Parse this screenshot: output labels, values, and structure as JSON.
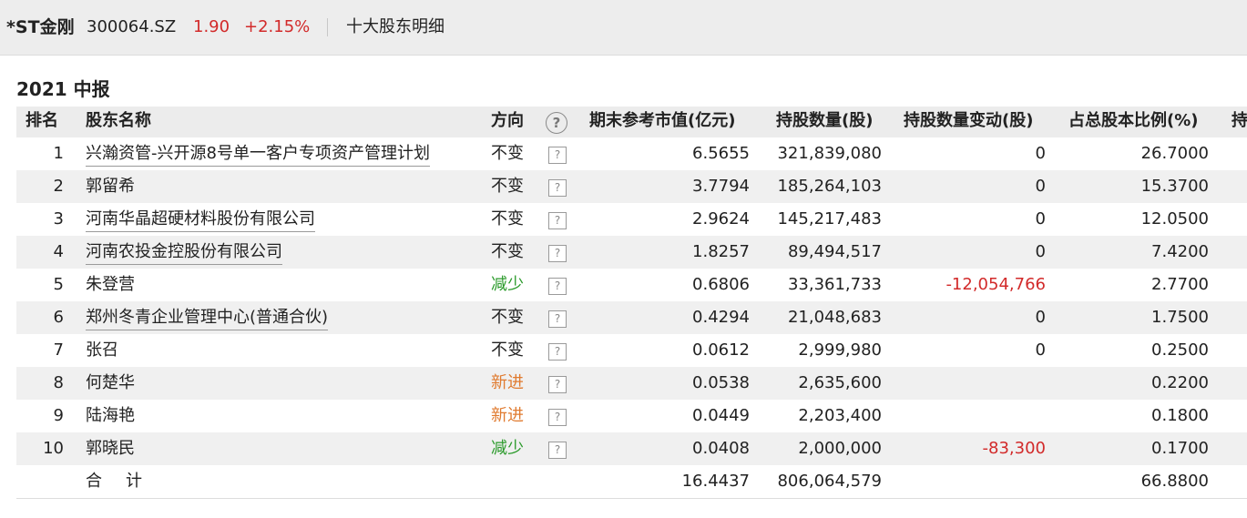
{
  "header": {
    "stock_name": "*ST金刚",
    "stock_code": "300064.SZ",
    "price": "1.90",
    "change": "+2.15%",
    "subtitle": "十大股东明细",
    "colors": {
      "price": "#d22a2a",
      "background": "#ededed"
    }
  },
  "section": {
    "title": "2021 中报"
  },
  "table": {
    "headers": {
      "rank": "排名",
      "name": "股东名称",
      "direction": "方向",
      "help_icon": "?",
      "market_value": "期末参考市值(亿元)",
      "shares": "持股数量(股)",
      "share_change": "持股数量变动(股)",
      "ratio": "占总股本比例(%)",
      "extra": "持"
    },
    "help_glyph": "?",
    "rows": [
      {
        "rank": "1",
        "name": "兴瀚资管-兴开源8号单一客户专项资产管理计划",
        "direction": "不变",
        "market_value": "6.5655",
        "shares": "321,839,080",
        "change": "0",
        "ratio": "26.7000"
      },
      {
        "rank": "2",
        "name": "郭留希",
        "direction": "不变",
        "market_value": "3.7794",
        "shares": "185,264,103",
        "change": "0",
        "ratio": "15.3700"
      },
      {
        "rank": "3",
        "name": "河南华晶超硬材料股份有限公司",
        "direction": "不变",
        "market_value": "2.9624",
        "shares": "145,217,483",
        "change": "0",
        "ratio": "12.0500"
      },
      {
        "rank": "4",
        "name": "河南农投金控股份有限公司",
        "direction": "不变",
        "market_value": "1.8257",
        "shares": "89,494,517",
        "change": "0",
        "ratio": "7.4200"
      },
      {
        "rank": "5",
        "name": "朱登营",
        "direction": "减少",
        "market_value": "0.6806",
        "shares": "33,361,733",
        "change": "-12,054,766",
        "ratio": "2.7700"
      },
      {
        "rank": "6",
        "name": "郑州冬青企业管理中心(普通合伙)",
        "direction": "不变",
        "market_value": "0.4294",
        "shares": "21,048,683",
        "change": "0",
        "ratio": "1.7500"
      },
      {
        "rank": "7",
        "name": "张召",
        "direction": "不变",
        "market_value": "0.0612",
        "shares": "2,999,980",
        "change": "0",
        "ratio": "0.2500"
      },
      {
        "rank": "8",
        "name": "何楚华",
        "direction": "新进",
        "market_value": "0.0538",
        "shares": "2,635,600",
        "change": "",
        "ratio": "0.2200"
      },
      {
        "rank": "9",
        "name": "陆海艳",
        "direction": "新进",
        "market_value": "0.0449",
        "shares": "2,203,400",
        "change": "",
        "ratio": "0.1800"
      },
      {
        "rank": "10",
        "name": "郭晓民",
        "direction": "减少",
        "market_value": "0.0408",
        "shares": "2,000,000",
        "change": "-83,300",
        "ratio": "0.1700"
      }
    ],
    "total": {
      "label": "合计",
      "market_value": "16.4437",
      "shares": "806,064,579",
      "ratio": "66.8800"
    },
    "direction_colors": {
      "不变": "#222222",
      "减少": "#2a9a2a",
      "新进": "#e07b30"
    },
    "negative_color": "#d22a2a"
  }
}
